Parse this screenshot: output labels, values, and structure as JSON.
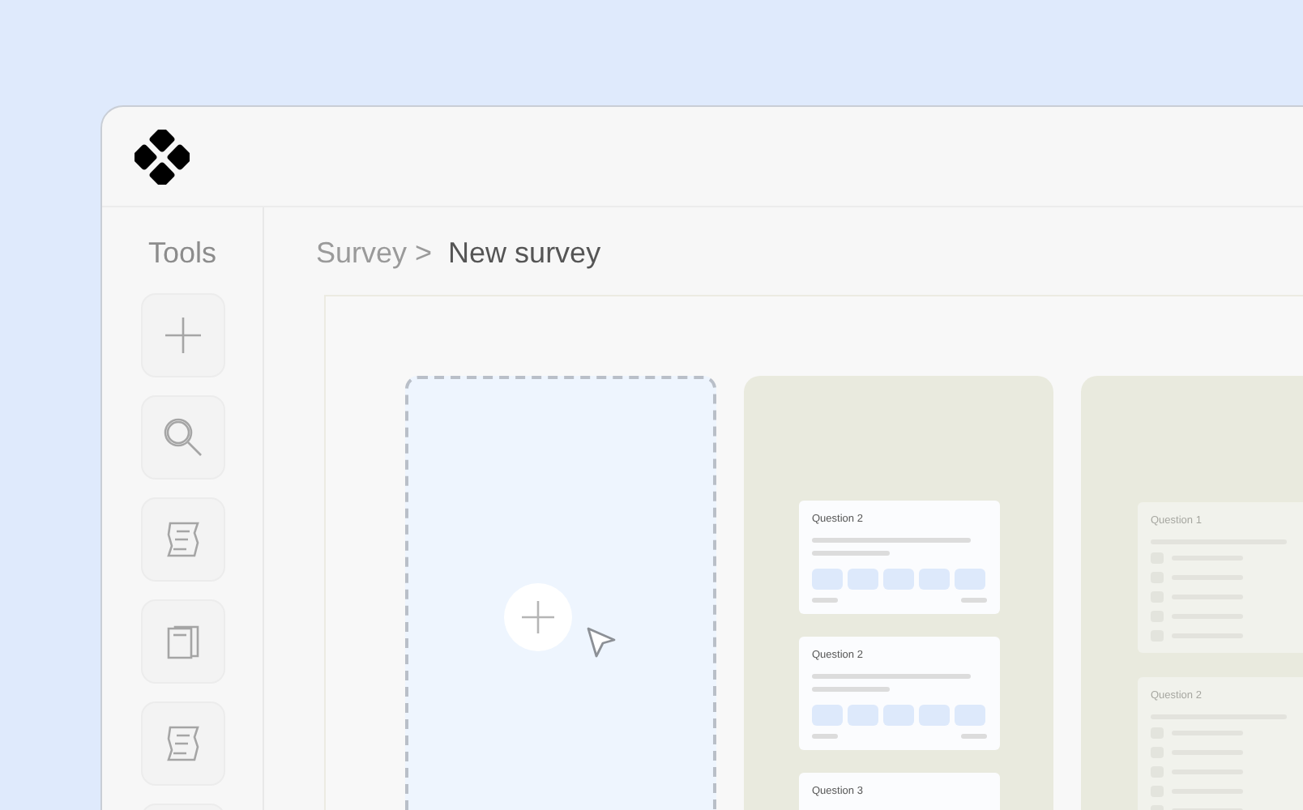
{
  "sidebar": {
    "title": "Tools",
    "tools": [
      {
        "kind": "plus"
      },
      {
        "kind": "search"
      },
      {
        "kind": "scroll"
      },
      {
        "kind": "pages"
      },
      {
        "kind": "scroll"
      },
      {
        "kind": "blank"
      }
    ]
  },
  "breadcrumb": {
    "parent": "Survey >",
    "current": "New survey"
  },
  "columns": [
    {
      "kind": "dropzone"
    },
    {
      "kind": "rating",
      "faded": false,
      "cards": [
        {
          "title": "Question 2"
        },
        {
          "title": "Question 2"
        },
        {
          "title": "Question 3"
        }
      ]
    },
    {
      "kind": "checkbox",
      "faded": true,
      "cards": [
        {
          "title": "Question 1"
        },
        {
          "title": "Question 2"
        }
      ]
    }
  ]
}
